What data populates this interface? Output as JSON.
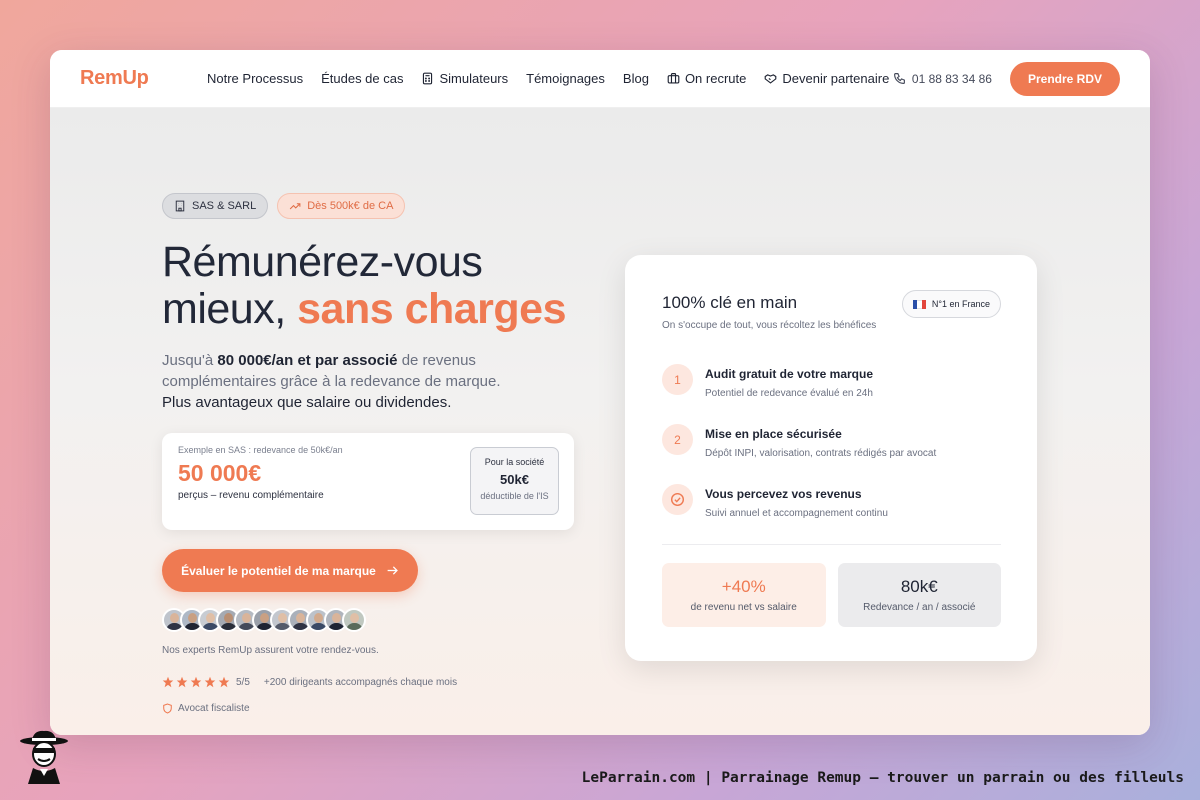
{
  "nav": {
    "logo": "RemUp",
    "links": [
      "Notre Processus",
      "Études de cas",
      "Simulateurs",
      "Témoignages",
      "Blog",
      "On recrute",
      "Devenir partenaire"
    ],
    "phone": "01 88 83 34 86",
    "cta": "Prendre RDV"
  },
  "hero": {
    "pill_1": "SAS & SARL",
    "pill_2": "Dès 500k€ de CA",
    "title_line1": "Rémunérez-vous",
    "title_line2_plain": "mieux, ",
    "title_line2_accent": "sans charges",
    "sub_pre": "Jusqu'à ",
    "sub_bold": "80 000€/an et par associé",
    "sub_post": " de revenus complémentaires grâce à la redevance de marque.",
    "sub_line2": "Plus avantageux que salaire ou dividendes.",
    "example": {
      "label": "Exemple en SAS : redevance de 50k€/an",
      "value": "50 000€",
      "desc": "perçus – revenu complémentaire",
      "box_title": "Pour la société",
      "box_value": "50k€",
      "box_desc": "déductible de l'IS"
    },
    "cta": "Évaluer le potentiel de ma marque",
    "experts": "Nos experts RemUp assurent votre rendez-vous.",
    "rating": "5/5",
    "rating_stars": 5,
    "rating_text": "+200 dirigeants accompagnés chaque mois",
    "lawyer": "Avocat fiscaliste"
  },
  "card": {
    "title": "100% clé en main",
    "subtitle": "On s'occupe de tout, vous récoltez les bénéfices",
    "badge": "N°1 en France",
    "steps": [
      {
        "num": "1",
        "title": "Audit gratuit de votre marque",
        "desc": "Potentiel de redevance évalué en 24h"
      },
      {
        "num": "2",
        "title": "Mise en place sécurisée",
        "desc": "Dépôt INPI, valorisation, contrats rédigés par avocat"
      },
      {
        "num": "",
        "title": "Vous percevez vos revenus",
        "desc": "Suivi annuel et accompagnement continu"
      }
    ],
    "stat_1_value": "+40%",
    "stat_1_label": "de revenu net vs salaire",
    "stat_2_value": "80k€",
    "stat_2_label": "Redevance / an / associé"
  },
  "footer": {
    "text": "LeParrain.com | Parrainage Remup — trouver un parrain ou des filleuls"
  },
  "colors": {
    "accent": "#ef7a52",
    "text": "#1f2433",
    "muted": "#6b7080"
  }
}
